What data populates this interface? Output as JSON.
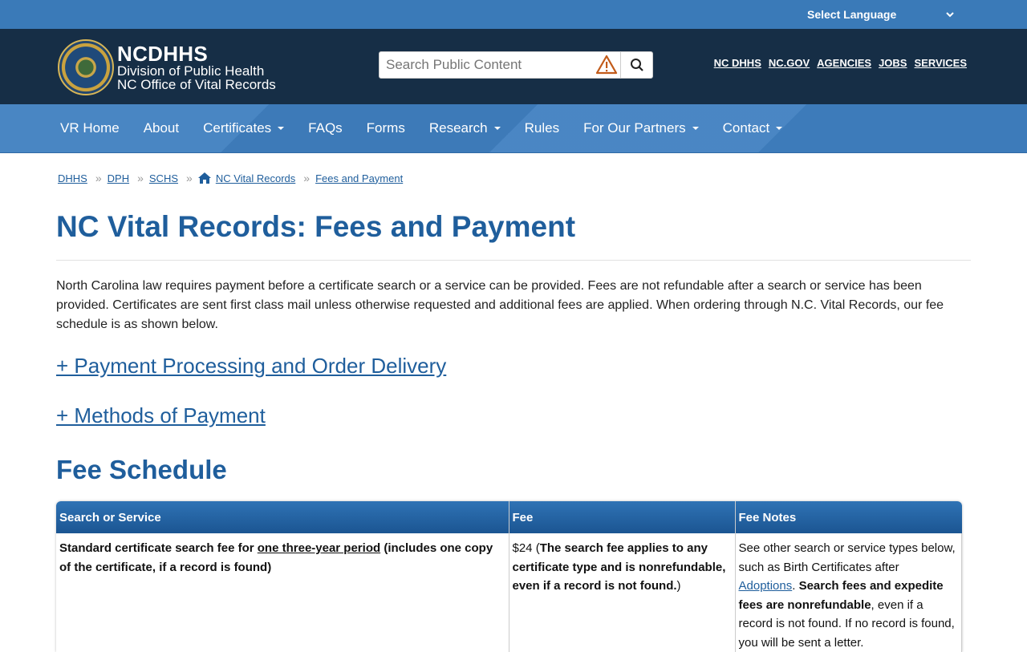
{
  "language": {
    "label": "Select Language"
  },
  "header": {
    "brand_name": "NCDHHS",
    "brand_sub1": "Division of Public Health",
    "brand_sub2": "NC Office of Vital Records",
    "search_placeholder": "Search Public Content",
    "top_links": [
      "NC DHHS",
      "NC.GOV",
      "AGENCIES",
      "JOBS",
      "SERVICES"
    ]
  },
  "nav": {
    "items": [
      {
        "label": "VR Home",
        "dropdown": false
      },
      {
        "label": "About",
        "dropdown": false
      },
      {
        "label": "Certificates",
        "dropdown": true
      },
      {
        "label": "FAQs",
        "dropdown": false
      },
      {
        "label": "Forms",
        "dropdown": false
      },
      {
        "label": "Research",
        "dropdown": true
      },
      {
        "label": "Rules",
        "dropdown": false
      },
      {
        "label": "For Our Partners",
        "dropdown": true
      },
      {
        "label": "Contact",
        "dropdown": true
      }
    ]
  },
  "breadcrumb": [
    "DHHS",
    "DPH",
    "SCHS",
    "NC Vital Records",
    "Fees and Payment"
  ],
  "page": {
    "title": "NC Vital Records: Fees and Payment",
    "intro": "North Carolina law requires payment before a certificate search or a service can be provided. Fees are not refundable after a search or service has been provided. Certificates are sent first class mail unless otherwise requested and additional fees are applied. When ordering through N.C. Vital Records, our fee schedule is as shown below.",
    "accordion1": "+ Payment Processing and Order Delivery",
    "accordion2": "+ Methods of Payment",
    "fee_heading": "Fee Schedule"
  },
  "fee_table": {
    "headers": [
      "Search or Service",
      "Fee",
      "Fee Notes"
    ],
    "row1": {
      "service_pre": "Standard certificate search fee for ",
      "service_u": "one three-year period",
      "service_post": " (includes one copy of the certificate, if a record is found)",
      "fee_amount": "$24 (",
      "fee_bold": "The search fee applies to any certificate type and is nonrefundable, even if a record is not found.",
      "fee_close": ")",
      "notes_pre": "See other search or service types below, such as Birth Certificates after ",
      "notes_link": "Adoptions",
      "notes_dot": ".",
      "notes_bold": "Search fees and expedite fees are nonrefundable",
      "notes_post": ", even if a record is not found. If no record is found, you will be sent a letter."
    }
  },
  "colors": {
    "accent": "#1f5e9c",
    "header_bg": "#162e46",
    "nav_bg": "#3f7fc0",
    "lang_bg": "#3a7ab8",
    "warning": "#c25b1a"
  }
}
